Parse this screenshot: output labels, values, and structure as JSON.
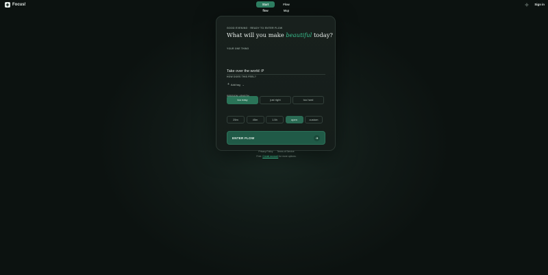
{
  "header": {
    "brand": "Focus!",
    "nav": [
      {
        "label": "Start flow",
        "active": true
      },
      {
        "label": "Flow Map",
        "active": false
      }
    ],
    "signin": "Sign in"
  },
  "card": {
    "eyebrow": "GOOD EVENING · READY TO ENTER FLOW",
    "headline": {
      "pre": "What will you make ",
      "accent": "beautiful",
      "post": " today?"
    },
    "one_thing_label": "YOUR ONE THING",
    "task_value": "Take over the world :P",
    "add_tag": "Add tag",
    "feel_label": "HOW DOES THIS FEEL?",
    "feel_options": [
      {
        "label": "too easy",
        "active": true
      },
      {
        "label": "just right",
        "active": false
      },
      {
        "label": "too hard",
        "active": false
      }
    ],
    "length_label": "SESSION LENGTH",
    "length_options": [
      {
        "label": "25m",
        "active": false
      },
      {
        "label": "45m",
        "active": false
      },
      {
        "label": "1.5h",
        "active": false
      },
      {
        "label": "open",
        "active": true
      },
      {
        "label": "custom",
        "active": false
      }
    ],
    "enter_label": "ENTER FLOW",
    "footer": {
      "privacy": "Privacy Policy",
      "terms": "Terms of Service",
      "note_pre": "Free. ",
      "note_link": "Create account",
      "note_post": " for more options."
    }
  },
  "colors": {
    "accent": "#39c08e",
    "button": "#2f8264",
    "background": "#0f1714"
  },
  "icons": {
    "brand": "flower-icon",
    "theme": "sun-icon",
    "enter": "arrow-right-icon"
  }
}
